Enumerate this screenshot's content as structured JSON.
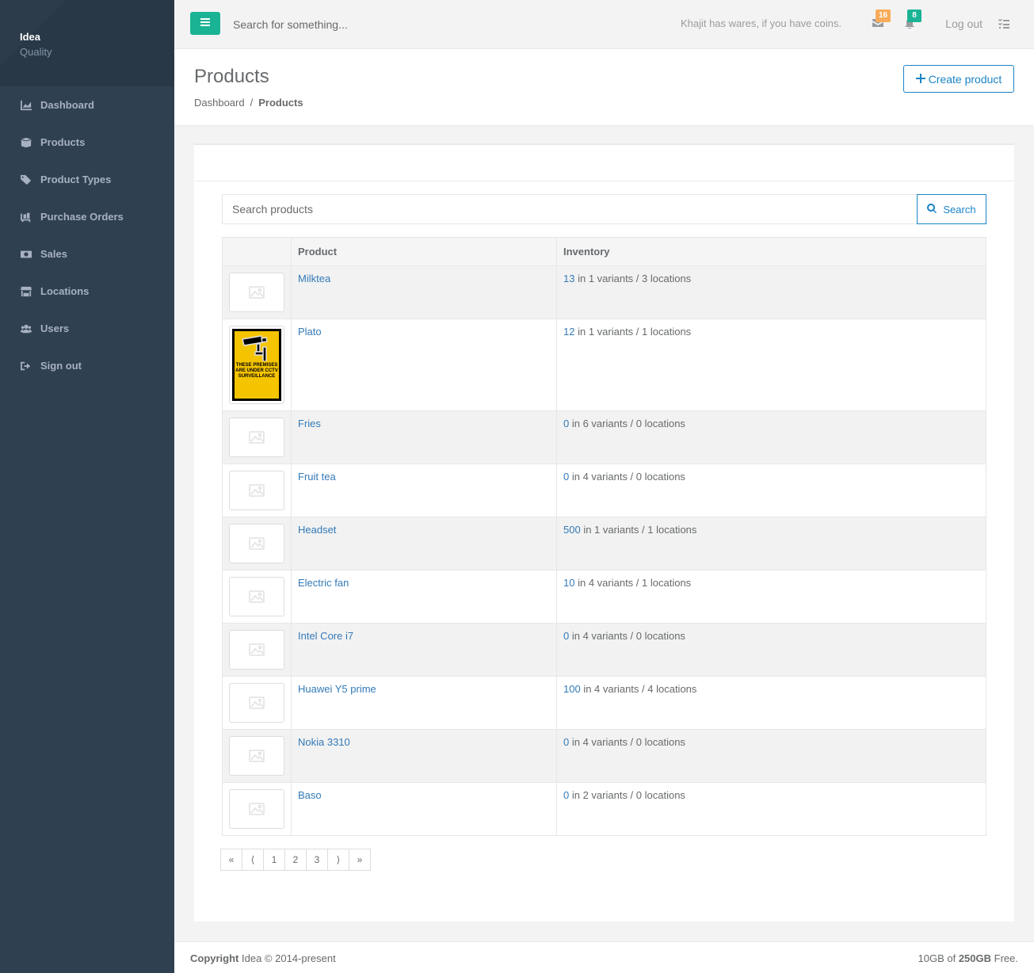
{
  "brand": {
    "name": "Idea",
    "subtitle": "Quality"
  },
  "sidebar": {
    "items": [
      {
        "label": "Dashboard",
        "icon": "chart-area-icon"
      },
      {
        "label": "Products",
        "icon": "box-open-icon"
      },
      {
        "label": "Product Types",
        "icon": "tag-icon"
      },
      {
        "label": "Purchase Orders",
        "icon": "pallet-icon"
      },
      {
        "label": "Sales",
        "icon": "money-bill-icon"
      },
      {
        "label": "Locations",
        "icon": "store-icon"
      },
      {
        "label": "Users",
        "icon": "users-icon"
      },
      {
        "label": "Sign out",
        "icon": "sign-out-icon"
      }
    ]
  },
  "topbar": {
    "search_placeholder": "Search for something...",
    "welcome": "Khajit has wares, if you have coins.",
    "messages_count": "16",
    "alerts_count": "8",
    "logout_label": "Log out"
  },
  "heading": {
    "title": "Products",
    "breadcrumb": [
      "Dashboard",
      "Products"
    ],
    "create_label": "Create product"
  },
  "search": {
    "placeholder": "Search products",
    "button_label": "Search"
  },
  "table": {
    "headers": [
      "",
      "Product",
      "Inventory"
    ],
    "rows": [
      {
        "name": "Milktea",
        "qty": "13",
        "detail": "in 1 variants / 3 locations"
      },
      {
        "name": "Plato",
        "qty": "12",
        "detail": "in 1 variants / 1 locations",
        "image": "cctv-sign",
        "image_text": "THESE PREMISES ARE UNDER CCTV SURVEILLANCE"
      },
      {
        "name": "Fries",
        "qty": "0",
        "detail": "in 6 variants / 0 locations"
      },
      {
        "name": "Fruit tea",
        "qty": "0",
        "detail": "in 4 variants / 0 locations"
      },
      {
        "name": "Headset",
        "qty": "500",
        "detail": "in 1 variants / 1 locations"
      },
      {
        "name": "Electric fan",
        "qty": "10",
        "detail": "in 4 variants / 1 locations"
      },
      {
        "name": "Intel Core i7",
        "qty": "0",
        "detail": "in 4 variants / 0 locations"
      },
      {
        "name": "Huawei Y5 prime",
        "qty": "100",
        "detail": "in 4 variants / 4 locations"
      },
      {
        "name": "Nokia 3310",
        "qty": "0",
        "detail": "in 4 variants / 0 locations"
      },
      {
        "name": "Baso",
        "qty": "0",
        "detail": "in 2 variants / 0 locations"
      }
    ]
  },
  "pagination": {
    "items": [
      "«",
      "⟨",
      "1",
      "2",
      "3",
      "⟩",
      "»"
    ]
  },
  "footer": {
    "copyright_label": "Copyright",
    "copyright_text": "Idea © 2014-present",
    "storage_used": "10GB of",
    "storage_total": "250GB",
    "storage_suffix": "Free."
  },
  "colors": {
    "sidebar": "#2f4050",
    "primary": "#1ab394",
    "link": "#337ab7",
    "accent_blue": "#1c84c6",
    "warning": "#f8ac59"
  }
}
